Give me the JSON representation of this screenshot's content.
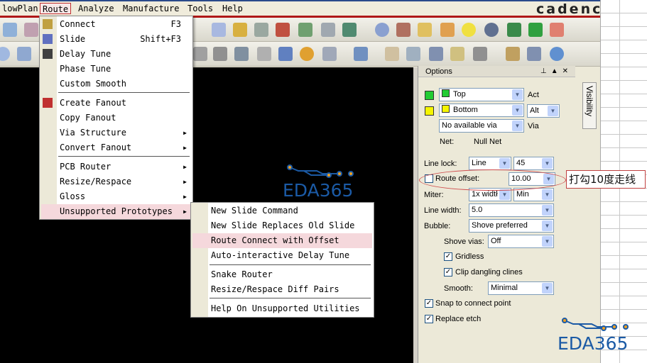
{
  "menubar": {
    "items": [
      "lowPlan",
      "Route",
      "Analyze",
      "Manufacture",
      "Tools",
      "Help"
    ],
    "brand": "cadence"
  },
  "route_menu": {
    "items": [
      {
        "label": "Connect",
        "shortcut": "F3"
      },
      {
        "label": "Slide",
        "shortcut": "Shift+F3"
      },
      {
        "label": "Delay Tune"
      },
      {
        "label": "Phase Tune"
      },
      {
        "label": "Custom Smooth"
      },
      {
        "label": "Create Fanout"
      },
      {
        "label": "Copy Fanout"
      },
      {
        "label": "Via Structure"
      },
      {
        "label": "Convert Fanout"
      },
      {
        "label": "PCB Router"
      },
      {
        "label": "Resize/Respace"
      },
      {
        "label": "Gloss"
      },
      {
        "label": "Unsupported Prototypes"
      }
    ]
  },
  "submenu": {
    "items": [
      "New Slide Command",
      "New Slide Replaces Old Slide",
      "Route Connect with Offset",
      "Auto-interactive Delay Tune",
      "Snake Router",
      "Resize/Respace Diff Pairs",
      "Help On Unsupported Utilities"
    ]
  },
  "options": {
    "title": "Options",
    "visibility_tab": "Visibility",
    "layer_top": "Top",
    "act": "Act",
    "layer_bottom": "Bottom",
    "alt": "Alt",
    "via": "No available via",
    "via_label": "Via",
    "net_label": "Net:",
    "net_value": "Null Net",
    "line_lock_label": "Line lock:",
    "line_lock": "Line",
    "angle": "45",
    "route_offset_label": "Route offset:",
    "route_offset": "10.00",
    "route_offset_checked": false,
    "miter_label": "Miter:",
    "miter": "1x widtł",
    "miter_mode": "Min",
    "line_width_label": "Line width:",
    "line_width": "5.0",
    "bubble_label": "Bubble:",
    "bubble": "Shove preferred",
    "shove_vias_label": "Shove vias:",
    "shove_vias": "Off",
    "gridless": "Gridless",
    "clip": "Clip dangling clines",
    "smooth_label": "Smooth:",
    "smooth": "Minimal",
    "snap": "Snap to connect point",
    "replace": "Replace etch",
    "colors": {
      "top": "#22cc33",
      "bottom": "#f5f500"
    }
  },
  "annotation": "打勾10度走线",
  "watermark": "EDA365"
}
